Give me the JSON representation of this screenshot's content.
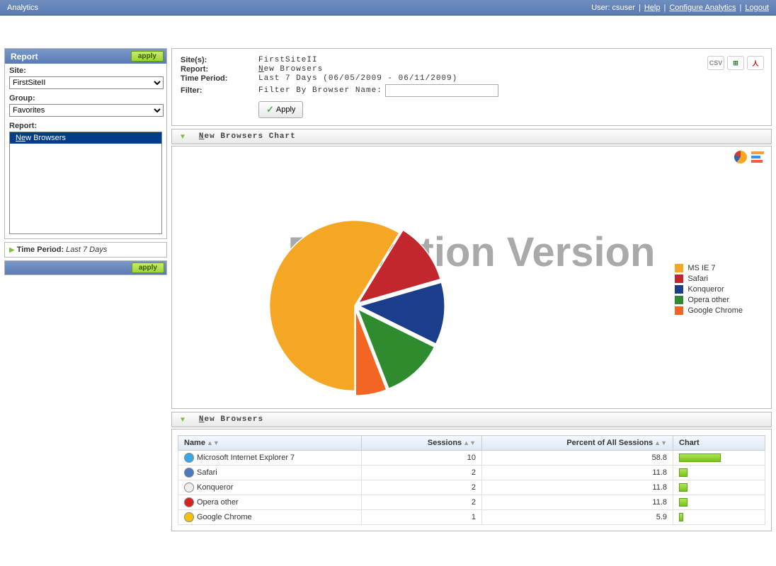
{
  "app": {
    "title": "Analytics"
  },
  "topbar": {
    "user_label": "User: csuser",
    "help": "Help",
    "configure": "Configure Analytics",
    "logout": "Logout"
  },
  "sidebar": {
    "panel_title": "Report",
    "apply": "apply",
    "site_label": "Site:",
    "site_value": "FirstSiteII",
    "group_label": "Group:",
    "group_value": "Favorites",
    "report_label": "Report:",
    "report_items": [
      "New Browsers"
    ],
    "time_period_label": "Time Period:",
    "time_period_value": "Last 7 Days"
  },
  "meta": {
    "sites_label": "Site(s):",
    "sites_value": "FirstSiteII",
    "report_label": "Report:",
    "report_value": "New Browsers",
    "time_label": "Time Period:",
    "time_value": "Last 7 Days (06/05/2009 - 06/11/2009)",
    "filter_label": "Filter:",
    "filter_placeholder": "Filter By Browser Name:",
    "apply": "Apply",
    "export": {
      "csv": "CSV",
      "xls": "XLS",
      "pdf": "PDF"
    }
  },
  "chart": {
    "section_title": "New Browsers Chart",
    "watermark": "Evaluation Version"
  },
  "chart_data": {
    "type": "pie",
    "title": "New Browsers Chart",
    "series": [
      {
        "name": "MS IE 7",
        "value": 58.8,
        "color": "#F5A623"
      },
      {
        "name": "Safari",
        "value": 11.8,
        "color": "#C1272D"
      },
      {
        "name": "Konqueror",
        "value": 11.8,
        "color": "#1B3E8C"
      },
      {
        "name": "Opera other",
        "value": 11.8,
        "color": "#2E8B2E"
      },
      {
        "name": "Google Chrome",
        "value": 5.9,
        "color": "#F26522"
      }
    ]
  },
  "table": {
    "section_title": "New Browsers",
    "columns": {
      "name": "Name",
      "sessions": "Sessions",
      "percent": "Percent of All Sessions",
      "chart": "Chart"
    },
    "rows": [
      {
        "name": "Microsoft Internet Explorer 7",
        "sessions": "10",
        "percent": "58.8",
        "icon_color": "#3aa7e6"
      },
      {
        "name": "Safari",
        "sessions": "2",
        "percent": "11.8",
        "icon_color": "#4a7abf"
      },
      {
        "name": "Konqueror",
        "sessions": "2",
        "percent": "11.8",
        "icon_color": "#eeeeee"
      },
      {
        "name": "Opera other",
        "sessions": "2",
        "percent": "11.8",
        "icon_color": "#d62222"
      },
      {
        "name": "Google Chrome",
        "sessions": "1",
        "percent": "5.9",
        "icon_color": "#f4c20d"
      }
    ]
  }
}
